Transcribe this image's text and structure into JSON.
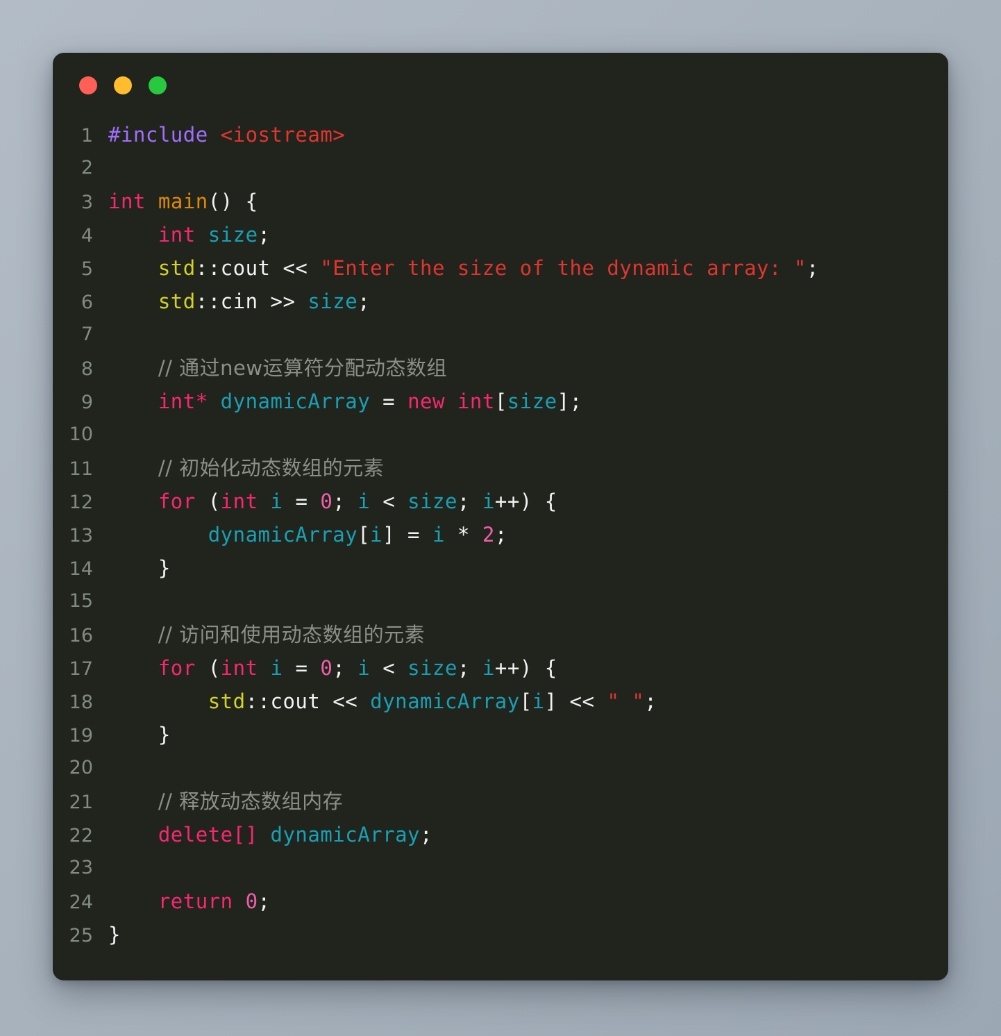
{
  "window": {
    "title": "code-snippet-window",
    "background_color": "#21241d",
    "page_background_color": "#aab4bf",
    "traffic_lights": [
      {
        "name": "close-button",
        "label": "Close",
        "color": "#ff5f56"
      },
      {
        "name": "minimize-button",
        "label": "Minimize",
        "color": "#ffbd2e"
      },
      {
        "name": "maximize-button",
        "label": "Maximize",
        "color": "#27c93f"
      }
    ]
  },
  "editor": {
    "language": "C++",
    "gutter_color": "#808b82",
    "theme_colors": {
      "keyword": "#f92672",
      "preprocessor": "#a16eff",
      "string": "#e3342f",
      "comment": "#8c8f88",
      "function": "#dd8800",
      "variable": "#18a0b5",
      "namespace": "#d4d422",
      "number": "#ef5fa8",
      "plain": "#f2f2f2"
    },
    "lines": [
      {
        "no": "1",
        "tokens": [
          {
            "t": "#include",
            "c": "preproc"
          },
          {
            "t": " ",
            "c": "plain"
          },
          {
            "t": "<iostream>",
            "c": "string"
          }
        ]
      },
      {
        "no": "2",
        "tokens": []
      },
      {
        "no": "3",
        "tokens": [
          {
            "t": "int",
            "c": "keyword"
          },
          {
            "t": " ",
            "c": "plain"
          },
          {
            "t": "main",
            "c": "func"
          },
          {
            "t": "() {",
            "c": "plain"
          }
        ]
      },
      {
        "no": "4",
        "tokens": [
          {
            "t": "    ",
            "c": "plain"
          },
          {
            "t": "int",
            "c": "keyword"
          },
          {
            "t": " ",
            "c": "plain"
          },
          {
            "t": "size",
            "c": "var"
          },
          {
            "t": ";",
            "c": "plain"
          }
        ]
      },
      {
        "no": "5",
        "tokens": [
          {
            "t": "    ",
            "c": "plain"
          },
          {
            "t": "std",
            "c": "ns"
          },
          {
            "t": "::cout << ",
            "c": "plain"
          },
          {
            "t": "\"Enter the size of the dynamic array: \"",
            "c": "string"
          },
          {
            "t": ";",
            "c": "plain"
          }
        ]
      },
      {
        "no": "6",
        "tokens": [
          {
            "t": "    ",
            "c": "plain"
          },
          {
            "t": "std",
            "c": "ns"
          },
          {
            "t": "::cin >> ",
            "c": "plain"
          },
          {
            "t": "size",
            "c": "var"
          },
          {
            "t": ";",
            "c": "plain"
          }
        ]
      },
      {
        "no": "7",
        "tokens": []
      },
      {
        "no": "8",
        "tokens": [
          {
            "t": "    ",
            "c": "plain"
          },
          {
            "t": "// 通过new运算符分配动态数组",
            "c": "comment"
          }
        ]
      },
      {
        "no": "9",
        "tokens": [
          {
            "t": "    ",
            "c": "plain"
          },
          {
            "t": "int",
            "c": "keyword"
          },
          {
            "t": "* ",
            "c": "keyword"
          },
          {
            "t": "dynamicArray",
            "c": "var"
          },
          {
            "t": " = ",
            "c": "plain"
          },
          {
            "t": "new",
            "c": "keyword"
          },
          {
            "t": " ",
            "c": "plain"
          },
          {
            "t": "int",
            "c": "keyword"
          },
          {
            "t": "[",
            "c": "plain"
          },
          {
            "t": "size",
            "c": "var"
          },
          {
            "t": "];",
            "c": "plain"
          }
        ]
      },
      {
        "no": "10",
        "tokens": []
      },
      {
        "no": "11",
        "tokens": [
          {
            "t": "    ",
            "c": "plain"
          },
          {
            "t": "// 初始化动态数组的元素",
            "c": "comment"
          }
        ]
      },
      {
        "no": "12",
        "tokens": [
          {
            "t": "    ",
            "c": "plain"
          },
          {
            "t": "for",
            "c": "keyword"
          },
          {
            "t": " (",
            "c": "plain"
          },
          {
            "t": "int",
            "c": "keyword"
          },
          {
            "t": " ",
            "c": "plain"
          },
          {
            "t": "i",
            "c": "var"
          },
          {
            "t": " = ",
            "c": "plain"
          },
          {
            "t": "0",
            "c": "number"
          },
          {
            "t": "; ",
            "c": "plain"
          },
          {
            "t": "i",
            "c": "var"
          },
          {
            "t": " < ",
            "c": "plain"
          },
          {
            "t": "size",
            "c": "var"
          },
          {
            "t": "; ",
            "c": "plain"
          },
          {
            "t": "i",
            "c": "var"
          },
          {
            "t": "++) {",
            "c": "plain"
          }
        ]
      },
      {
        "no": "13",
        "tokens": [
          {
            "t": "        ",
            "c": "plain"
          },
          {
            "t": "dynamicArray",
            "c": "var"
          },
          {
            "t": "[",
            "c": "plain"
          },
          {
            "t": "i",
            "c": "var"
          },
          {
            "t": "] = ",
            "c": "plain"
          },
          {
            "t": "i",
            "c": "var"
          },
          {
            "t": " * ",
            "c": "plain"
          },
          {
            "t": "2",
            "c": "number"
          },
          {
            "t": ";",
            "c": "plain"
          }
        ]
      },
      {
        "no": "14",
        "tokens": [
          {
            "t": "    }",
            "c": "plain"
          }
        ]
      },
      {
        "no": "15",
        "tokens": []
      },
      {
        "no": "16",
        "tokens": [
          {
            "t": "    ",
            "c": "plain"
          },
          {
            "t": "// 访问和使用动态数组的元素",
            "c": "comment"
          }
        ]
      },
      {
        "no": "17",
        "tokens": [
          {
            "t": "    ",
            "c": "plain"
          },
          {
            "t": "for",
            "c": "keyword"
          },
          {
            "t": " (",
            "c": "plain"
          },
          {
            "t": "int",
            "c": "keyword"
          },
          {
            "t": " ",
            "c": "plain"
          },
          {
            "t": "i",
            "c": "var"
          },
          {
            "t": " = ",
            "c": "plain"
          },
          {
            "t": "0",
            "c": "number"
          },
          {
            "t": "; ",
            "c": "plain"
          },
          {
            "t": "i",
            "c": "var"
          },
          {
            "t": " < ",
            "c": "plain"
          },
          {
            "t": "size",
            "c": "var"
          },
          {
            "t": "; ",
            "c": "plain"
          },
          {
            "t": "i",
            "c": "var"
          },
          {
            "t": "++) {",
            "c": "plain"
          }
        ]
      },
      {
        "no": "18",
        "tokens": [
          {
            "t": "        ",
            "c": "plain"
          },
          {
            "t": "std",
            "c": "ns"
          },
          {
            "t": "::cout << ",
            "c": "plain"
          },
          {
            "t": "dynamicArray",
            "c": "var"
          },
          {
            "t": "[",
            "c": "plain"
          },
          {
            "t": "i",
            "c": "var"
          },
          {
            "t": "] << ",
            "c": "plain"
          },
          {
            "t": "\" \"",
            "c": "string"
          },
          {
            "t": ";",
            "c": "plain"
          }
        ]
      },
      {
        "no": "19",
        "tokens": [
          {
            "t": "    }",
            "c": "plain"
          }
        ]
      },
      {
        "no": "20",
        "tokens": []
      },
      {
        "no": "21",
        "tokens": [
          {
            "t": "    ",
            "c": "plain"
          },
          {
            "t": "// 释放动态数组内存",
            "c": "comment"
          }
        ]
      },
      {
        "no": "22",
        "tokens": [
          {
            "t": "    ",
            "c": "plain"
          },
          {
            "t": "delete[]",
            "c": "keyword"
          },
          {
            "t": " ",
            "c": "plain"
          },
          {
            "t": "dynamicArray",
            "c": "var"
          },
          {
            "t": ";",
            "c": "plain"
          }
        ]
      },
      {
        "no": "23",
        "tokens": []
      },
      {
        "no": "24",
        "tokens": [
          {
            "t": "    ",
            "c": "plain"
          },
          {
            "t": "return",
            "c": "keyword"
          },
          {
            "t": " ",
            "c": "plain"
          },
          {
            "t": "0",
            "c": "number"
          },
          {
            "t": ";",
            "c": "plain"
          }
        ]
      },
      {
        "no": "25",
        "tokens": [
          {
            "t": "}",
            "c": "plain"
          }
        ]
      }
    ]
  }
}
